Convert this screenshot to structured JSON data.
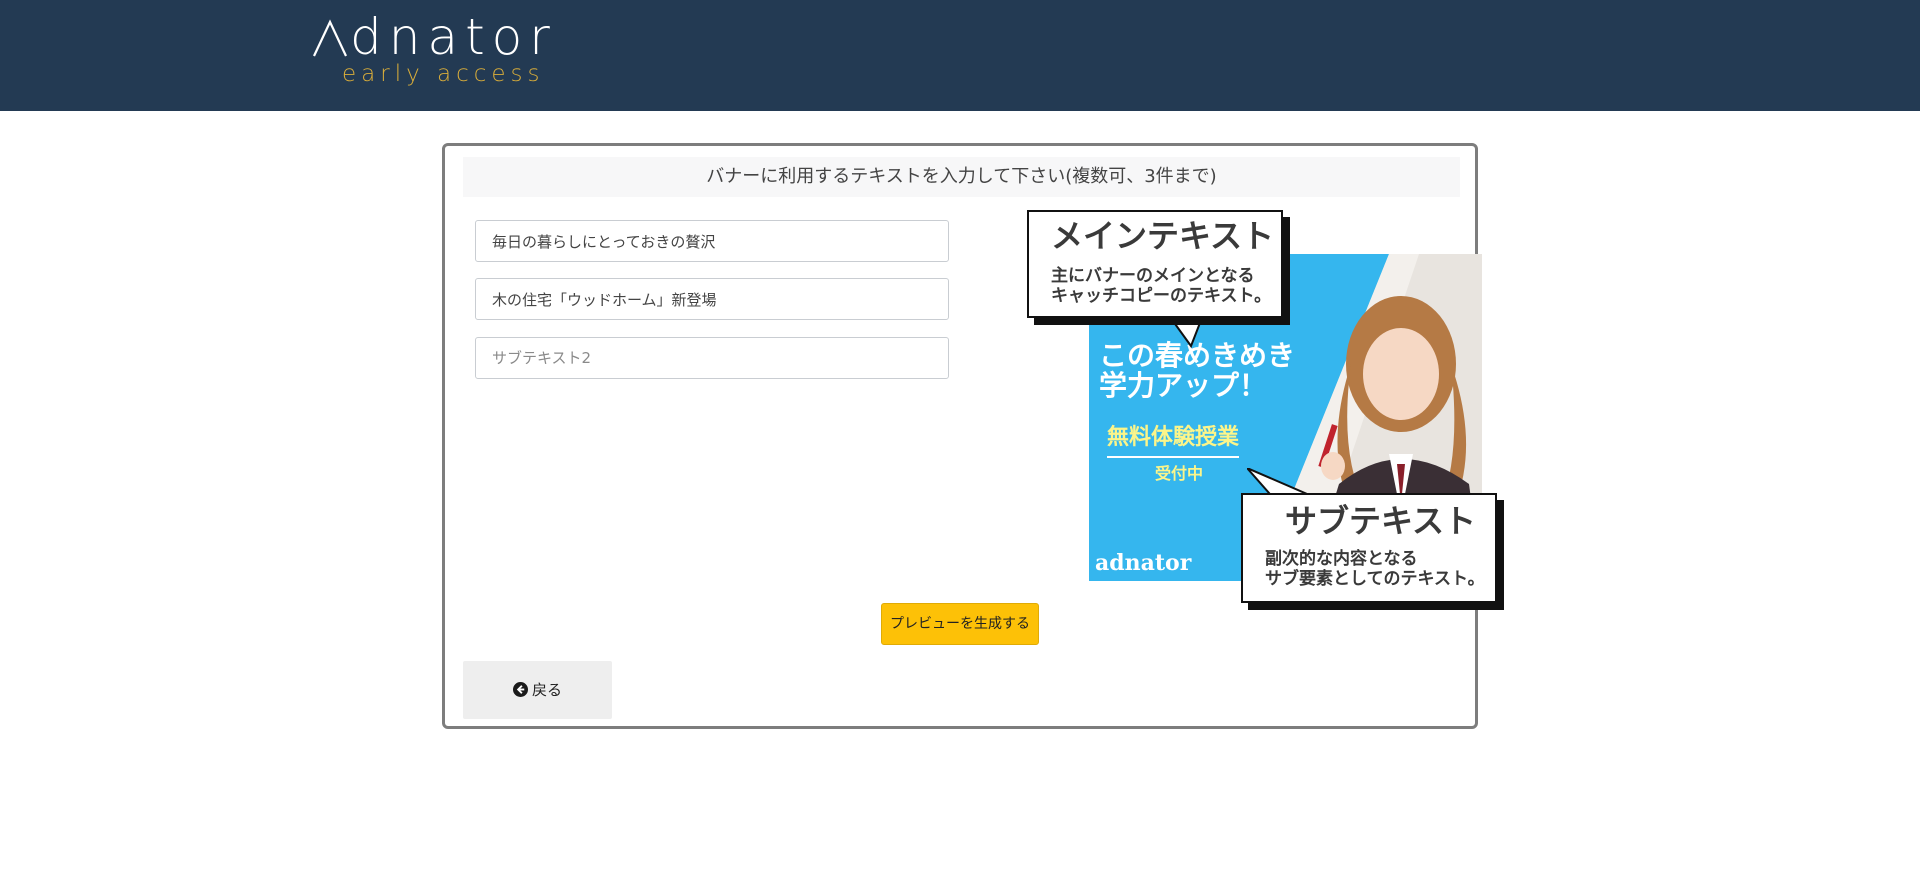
{
  "header": {
    "logo_main": "dnator",
    "logo_sub": "early access",
    "logo_icon": "lambda-a-logo-icon",
    "bg_color": "#233a53",
    "accent_color": "#d9ad3a"
  },
  "card": {
    "title": "バナーに利用するテキストを入力して下さい(複数可、3件まで)"
  },
  "fields": [
    {
      "value": "毎日の暮らしにとっておきの贅沢",
      "placeholder": ""
    },
    {
      "value": "木の住宅「ウッドホーム」新登場",
      "placeholder": ""
    },
    {
      "value": "",
      "placeholder": "サブテキスト2"
    }
  ],
  "banner": {
    "main_title": "メインテキスト",
    "main_body_1": "主にバナーのメインとなる",
    "main_body_2": "キャッチコピーのテキスト。",
    "ad_line1": "この春めきめき",
    "ad_line2": "学力アップ！",
    "ad_free": "無料体験授業",
    "ad_accept": "受付中",
    "ad_brand": "adnator",
    "sub_title": "サブテキスト",
    "sub_body_1": "副次的な内容となる",
    "sub_body_2": "サブ要素としてのテキスト。",
    "ad_bg_color": "#35b6ee",
    "ad_highlight_color": "#fbf58a"
  },
  "buttons": {
    "preview_label": "プレビューを生成する",
    "preview_color": "#fdc107",
    "back_label": "戻る",
    "back_icon": "arrow-circle-left-icon"
  }
}
